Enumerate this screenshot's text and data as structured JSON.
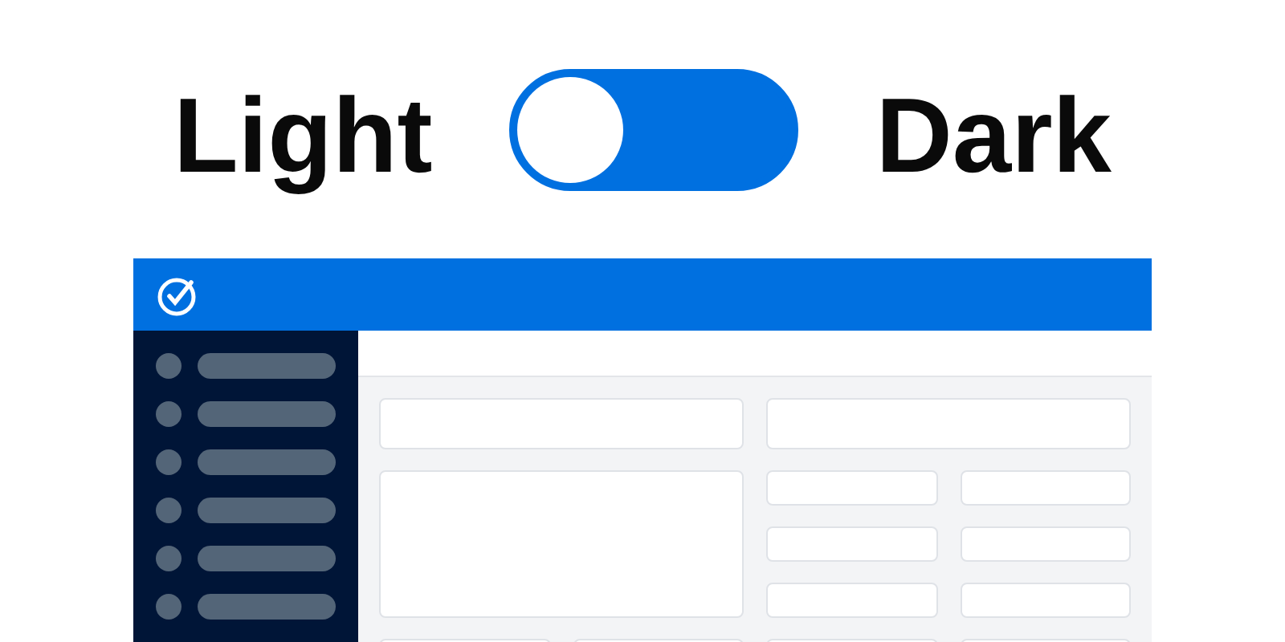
{
  "theme_toggle": {
    "left_label": "Light",
    "right_label": "Dark",
    "on": false
  }
}
